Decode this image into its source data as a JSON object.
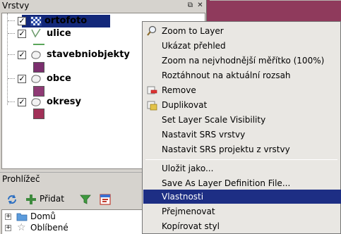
{
  "layers_panel": {
    "title": "Vrstvy",
    "layers": [
      {
        "name": "ortofoto",
        "checked": true,
        "selected": true,
        "icon": "raster-checker-icon"
      },
      {
        "name": "ulice",
        "checked": true,
        "selected": false,
        "icon": "line-layer-icon",
        "legend": "line",
        "legend_color": "#5aa65a"
      },
      {
        "name": "stavebniobjekty",
        "checked": true,
        "selected": false,
        "icon": "polygon-layer-icon",
        "legend": "fill",
        "legend_color": "#7b2f6e"
      },
      {
        "name": "obce",
        "checked": true,
        "selected": false,
        "icon": "polygon-layer-icon",
        "legend": "fill",
        "legend_color": "#8f3a75"
      },
      {
        "name": "okresy",
        "checked": true,
        "selected": false,
        "icon": "polygon-layer-icon",
        "legend": "fill",
        "legend_color": "#a13058"
      }
    ]
  },
  "browser_panel": {
    "title": "Prohlížeč",
    "add_label": "Přidat",
    "items": [
      {
        "label": "Domů",
        "icon": "folder-icon"
      },
      {
        "label": "Oblíbené",
        "icon": "star-icon"
      }
    ]
  },
  "context_menu": {
    "items": [
      {
        "label": "Zoom to Layer",
        "icon": "zoom-layer-icon"
      },
      {
        "label": "Ukázat přehled"
      },
      {
        "label": "Zoom na nejvhodnější měřítko (100%)"
      },
      {
        "label": "Roztáhnout na aktuální rozsah"
      },
      {
        "label": "Remove",
        "icon": "remove-layer-icon"
      },
      {
        "label": "Duplikovat",
        "icon": "duplicate-layer-icon"
      },
      {
        "label": "Set Layer Scale Visibility"
      },
      {
        "label": "Nastavit SRS vrstvy"
      },
      {
        "label": "Nastavit SRS projektu z vrstvy"
      },
      {
        "label": "Uložit jako..."
      },
      {
        "label": "Save As Layer Definition File..."
      },
      {
        "label": "Vlastnosti",
        "highlighted": true
      },
      {
        "label": "Přejmenovat"
      },
      {
        "label": "Kopírovat styl"
      }
    ]
  },
  "colors": {
    "selection": "#13287a",
    "menu_highlight": "#1d2e84",
    "canvas": "#8f3a5c"
  }
}
